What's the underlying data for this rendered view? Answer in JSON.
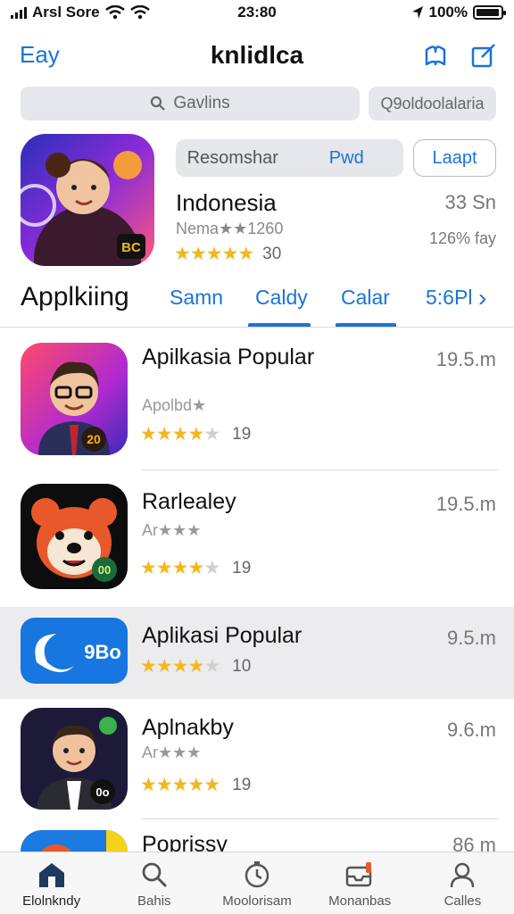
{
  "status_bar": {
    "carrier": "Arsl Sore",
    "time": "23:80",
    "battery_text": "100%",
    "battery_level": 0.95
  },
  "nav": {
    "back_label": "Eay",
    "title": "knlidlca",
    "icons": [
      "book-icon",
      "compose-icon"
    ]
  },
  "search": {
    "placeholder": "Gavlins",
    "filter_label": "Q9oldoolalaria"
  },
  "featured": {
    "segment": [
      "Resomshar",
      "Pwd"
    ],
    "active_segment": 1,
    "get_label": "Laapt",
    "name": "Indonesia",
    "subtitle": "Nema★★1260",
    "size": "33 Sn",
    "meta": "126% fay",
    "rating": 4.5,
    "rating_count": "30",
    "icon_badge": "BC"
  },
  "categories": {
    "title": "Applkiing",
    "tabs": [
      "Samn",
      "Caldy",
      "Calar",
      "5:6Pl"
    ],
    "active_tab": 1
  },
  "apps": [
    {
      "name": "Apilkasia Popular",
      "subtitle": "Apolbd★",
      "rating": 4,
      "count": "19",
      "size": "19.5.m",
      "badge": "20",
      "highlight": false
    },
    {
      "name": "Rarlealey",
      "subtitle": "Ar★★★",
      "rating": 4,
      "count": "19",
      "size": "19.5.m",
      "badge": "00",
      "highlight": false
    },
    {
      "name": "Aplikasi Popular",
      "subtitle": "",
      "rating": 4,
      "count": "10",
      "size": "9.5.m",
      "badge": "9Bo",
      "highlight": true
    },
    {
      "name": "Aplnakby",
      "subtitle": "Ar★★★",
      "rating": 4.5,
      "count": "19",
      "size": "9.6.m",
      "badge": "0o",
      "highlight": false
    },
    {
      "name": "Poprissy",
      "subtitle": "",
      "rating": 0,
      "count": "",
      "size": "86 m",
      "badge": "",
      "highlight": false
    }
  ],
  "tab_bar": [
    {
      "label": "Elolnkndy",
      "icon": "home-icon",
      "active": true
    },
    {
      "label": "Bahis",
      "icon": "search-icon",
      "active": false
    },
    {
      "label": "Moolorisam",
      "icon": "clock-icon",
      "active": false
    },
    {
      "label": "Monanbas",
      "icon": "inbox-icon",
      "active": false
    },
    {
      "label": "Calles",
      "icon": "person-icon",
      "active": false
    }
  ],
  "colors": {
    "accent": "#1a73d9",
    "star": "#f2b71f",
    "highlight_row": "#ececee"
  }
}
